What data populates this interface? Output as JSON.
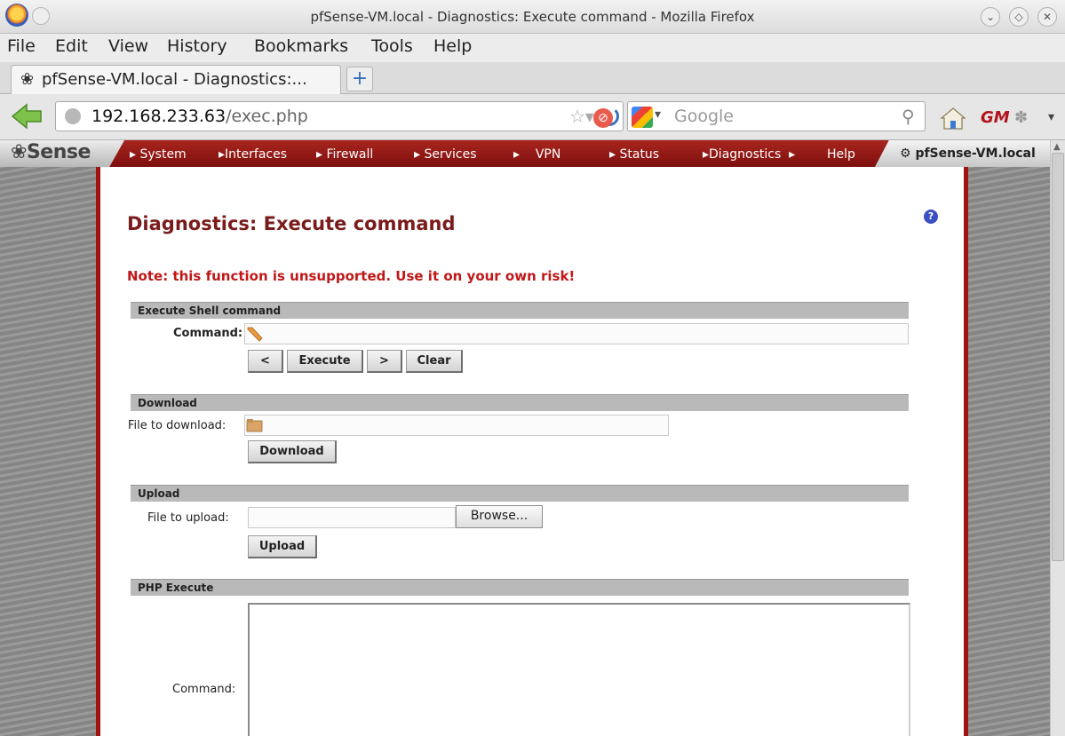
{
  "window": {
    "title": "pfSense-VM.local - Diagnostics: Execute command - Mozilla Firefox"
  },
  "menubar": {
    "items": [
      "File",
      "Edit",
      "View",
      "History",
      "Bookmarks",
      "Tools",
      "Help"
    ]
  },
  "tabs": [
    {
      "label": "pfSense-VM.local - Diagnostics:..."
    }
  ],
  "navbar": {
    "url_host": "192.168.233.63",
    "url_path": "/exec.php",
    "search_placeholder": "Google"
  },
  "pfsense": {
    "logo": "Sense",
    "nav": [
      "System",
      "Interfaces",
      "Firewall",
      "Services",
      "VPN",
      "Status",
      "Diagnostics",
      "Help"
    ],
    "hostname": "pfSense-VM.local"
  },
  "page": {
    "title": "Diagnostics: Execute command",
    "note": "Note: this function is unsupported. Use it on your own risk!",
    "shell": {
      "header": "Execute Shell command",
      "label": "Command:",
      "value": "",
      "btn_prev": "<",
      "btn_execute": "Execute",
      "btn_next": ">",
      "btn_clear": "Clear"
    },
    "download": {
      "header": "Download",
      "label": "File to download:",
      "value": "",
      "btn_download": "Download"
    },
    "upload": {
      "header": "Upload",
      "label": "File to upload:",
      "value": "",
      "btn_browse": "Browse...",
      "btn_upload": "Upload"
    },
    "php": {
      "header": "PHP Execute",
      "label": "Command:"
    }
  },
  "colors": {
    "brand_red": "#a11212",
    "title_red": "#7a1c1c",
    "note_red": "#c01818",
    "section_gray": "#b9b9b9"
  }
}
